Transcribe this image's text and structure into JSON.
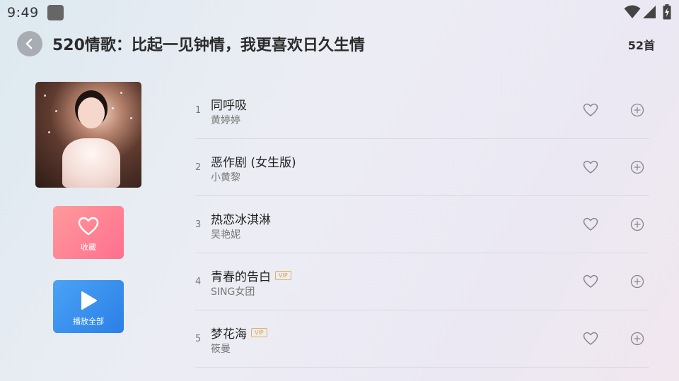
{
  "status_bar": {
    "time": "9:49",
    "icons": [
      "app-notification-icon",
      "wifi-icon",
      "signal-icon",
      "battery-charging-icon"
    ]
  },
  "header": {
    "back_icon": "chevron-left-icon",
    "title": "520情歌：比起一见钟情，我更喜欢日久生情",
    "count": "52首"
  },
  "left_panel": {
    "cover_alt": "playlist-cover-image",
    "favorite": {
      "label": "收藏",
      "icon": "heart-icon",
      "color": "#ff7a92"
    },
    "play_all": {
      "label": "播放全部",
      "icon": "play-icon",
      "color": "#3a8ff0"
    }
  },
  "songs": [
    {
      "index": "1",
      "title": "同呼吸",
      "artist": "黄婷婷",
      "vip": false
    },
    {
      "index": "2",
      "title": "恶作剧 (女生版)",
      "artist": "小黄黎",
      "vip": false
    },
    {
      "index": "3",
      "title": "热恋冰淇淋",
      "artist": "吴艳妮",
      "vip": false
    },
    {
      "index": "4",
      "title": "青春的告白",
      "artist": "SING女团",
      "vip": true,
      "vip_label": "VIP"
    },
    {
      "index": "5",
      "title": "梦花海",
      "artist": "筱曼",
      "vip": true,
      "vip_label": "VIP"
    }
  ],
  "row_actions": {
    "like_icon": "heart-outline-icon",
    "add_icon": "plus-circle-icon"
  }
}
